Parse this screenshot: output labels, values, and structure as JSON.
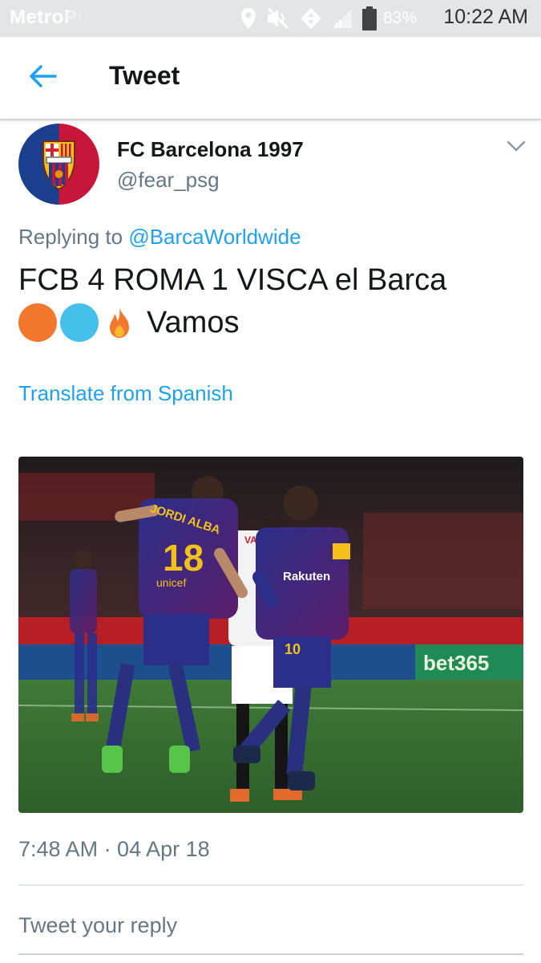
{
  "status_bar": {
    "carrier": "MetroPCS",
    "battery_percent": "83%",
    "time": "10:22 AM",
    "icons": [
      "location-icon",
      "mute-icon",
      "data-sync-icon",
      "signal-icon",
      "battery-icon"
    ]
  },
  "header": {
    "title": "Tweet",
    "back_icon": "arrow-left-icon"
  },
  "tweet": {
    "author_name": "FC Barcelona 1997",
    "author_handle": "@fear_psg",
    "replying_prefix": "Replying to",
    "replying_to": "@BarcaWorldwide",
    "text_line1": "FCB 4  ROMA 1 VISCA el Barca",
    "emoji_tail": "Vamos",
    "emoji": [
      "orange-circle",
      "blue-circle",
      "fire"
    ],
    "translate_label": "Translate from Spanish",
    "timestamp": "7:48 AM · 04 Apr 18"
  },
  "media": {
    "kind": "photo",
    "visible_text": {
      "jersey_name": "JORDI ALBA",
      "jersey_number_left": "18",
      "sponsor_left": "unicef",
      "sponsor_right": "Rakuten",
      "jersey_number_right": "10",
      "opponent_name": "VAZQ",
      "ad_board": "bet365"
    }
  },
  "reply": {
    "placeholder": "Tweet your reply"
  },
  "colors": {
    "accent": "#1da1f2",
    "secondary_text": "#657786",
    "status_bar_bg": "#e3e5e7",
    "emoji_orange": "#f4772e",
    "emoji_blue": "#45c0ea"
  }
}
